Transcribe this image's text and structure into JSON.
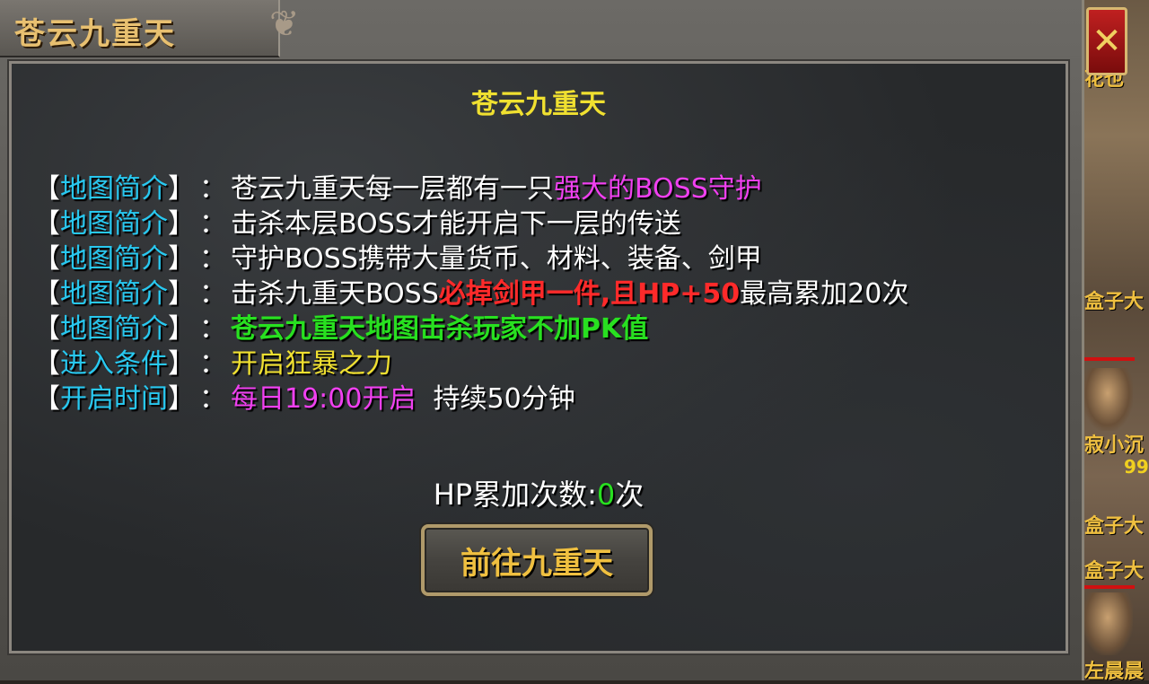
{
  "window": {
    "title": "苍云九重天",
    "close_glyph": "✕"
  },
  "panel": {
    "title": "苍云九重天",
    "rows": [
      {
        "key": "地图简介",
        "parts": [
          {
            "text": "苍云九重天每一层都有一只",
            "color": "white"
          },
          {
            "text": "强大的BOSS守护",
            "color": "magenta"
          }
        ]
      },
      {
        "key": "地图简介",
        "parts": [
          {
            "text": "击杀本层BOSS才能开启下一层的传送",
            "color": "white"
          }
        ]
      },
      {
        "key": "地图简介",
        "parts": [
          {
            "text": "守护BOSS携带大量货币、材料、装备、剑甲",
            "color": "white"
          }
        ]
      },
      {
        "key": "地图简介",
        "parts": [
          {
            "text": "击杀九重天BOSS",
            "color": "white"
          },
          {
            "text": "必掉剑甲一件,且HP+50",
            "color": "red"
          },
          {
            "text": "最高累加20次",
            "color": "white"
          }
        ]
      },
      {
        "key": "地图简介",
        "parts": [
          {
            "text": "苍云九重天地图击杀玩家不加PK值",
            "color": "green"
          }
        ]
      },
      {
        "key": "进入条件",
        "parts": [
          {
            "text": "开启狂暴之力",
            "color": "yellow"
          }
        ]
      },
      {
        "key": "开启时间",
        "parts": [
          {
            "text": "每日19:00开启",
            "color": "magenta"
          },
          {
            "text": "  持续50分钟",
            "color": "white"
          }
        ]
      }
    ],
    "bracket_open": "【",
    "bracket_close": "】",
    "colon": "：",
    "hp_label": "HP累加次数:",
    "hp_count": "0",
    "hp_suffix": "次",
    "go_button": "前往九重天"
  },
  "scene": {
    "labels": [
      "花也",
      "盒子大",
      "寂小沉",
      "盒子大",
      "盒子大",
      "左晨晨"
    ],
    "level": "99"
  },
  "colors": {
    "key": "#28c8f0",
    "white": "#ffffff",
    "magenta": "#f040f0",
    "red": "#ff2a2a",
    "green": "#28e020",
    "yellow": "#f0e030"
  }
}
